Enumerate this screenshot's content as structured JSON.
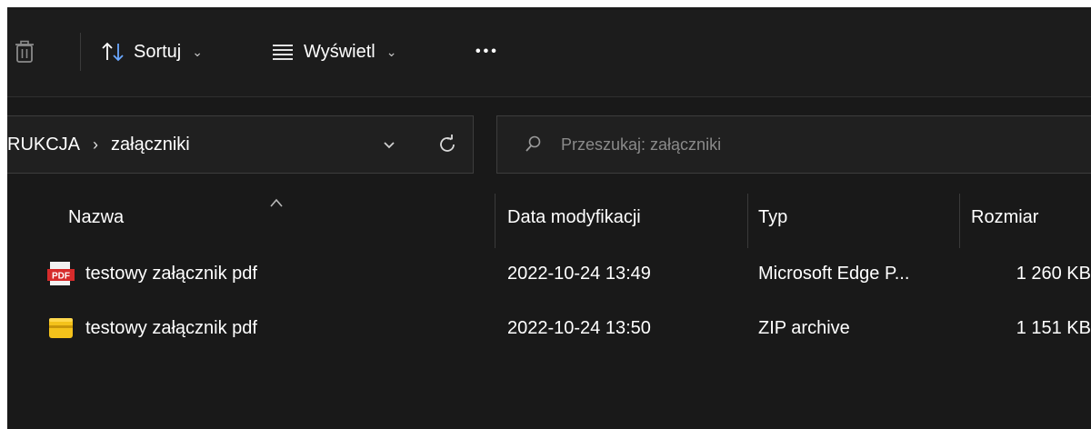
{
  "toolbar": {
    "delete_icon": "trash-icon",
    "sort": {
      "icon": "sort-arrows-icon",
      "label": "Sortuj",
      "chevron": "⌄"
    },
    "view": {
      "icon": "view-lines-icon",
      "label": "Wyświetl",
      "chevron": "⌄"
    },
    "more": "•••"
  },
  "address": {
    "breadcrumb": [
      "RUKCJA",
      "załączniki"
    ],
    "separator": "›",
    "dropdown_icon": "chevron-down-icon",
    "refresh_icon": "refresh-icon"
  },
  "search": {
    "placeholder": "Przeszukaj: załączniki",
    "value": ""
  },
  "columns": {
    "name": "Nazwa",
    "modified": "Data modyfikacji",
    "type": "Typ",
    "size": "Rozmiar"
  },
  "files": [
    {
      "icon": "pdf-file-icon",
      "name": "testowy załącznik pdf",
      "modified": "2022-10-24 13:49",
      "type": "Microsoft Edge P...",
      "size": "1 260 KB"
    },
    {
      "icon": "zip-archive-icon",
      "name": "testowy załącznik pdf",
      "modified": "2022-10-24 13:50",
      "type": "ZIP archive",
      "size": "1 151 KB"
    }
  ],
  "colors": {
    "background": "#191919",
    "toolbar": "#1c1c1c",
    "field": "#202020",
    "pdf_red": "#d62b2b",
    "zip_yellow": "#f4c21b"
  }
}
